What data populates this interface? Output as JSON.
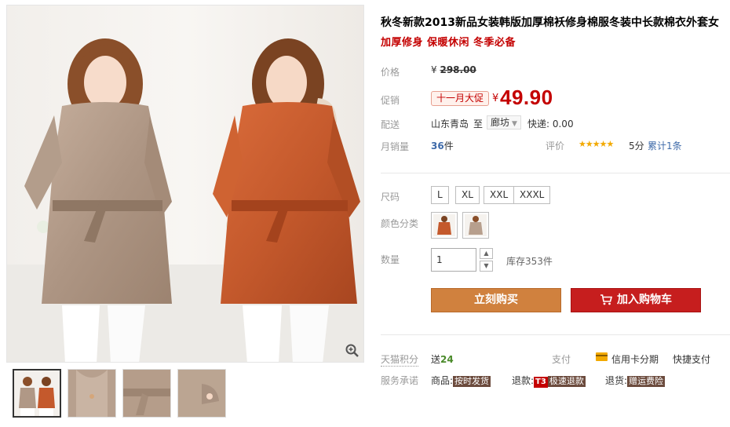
{
  "product": {
    "title": "秋冬新款2013新品女装韩版加厚棉袄修身棉服冬装中长款棉衣外套女",
    "subtitle": "加厚修身 保暖休闲 冬季必备"
  },
  "labels": {
    "price": "价格",
    "promo": "促销",
    "shipping": "配送",
    "monthly_sales": "月销量",
    "rating": "评价",
    "size": "尺码",
    "color": "颜色分类",
    "quantity": "数量",
    "points": "天猫积分",
    "payment": "支付",
    "promise": "服务承诺"
  },
  "price": {
    "currency": "¥",
    "original": "298.00",
    "promo_tag": "十一月大促",
    "current": "49.90"
  },
  "shipping": {
    "from": "山东青岛",
    "to_word": "至",
    "destination": "廊坊",
    "express": "快递: 0.00"
  },
  "sales": {
    "count": "36",
    "unit": "件",
    "stars": "★★★★★",
    "score": "5分",
    "reviews": "累计1条"
  },
  "sizes": [
    "L",
    "XL",
    "XXL",
    "XXXL"
  ],
  "colors": [
    {
      "name": "orange-coat",
      "hex": "#c4592c"
    },
    {
      "name": "beige-coat",
      "hex": "#b79f8d"
    }
  ],
  "quantity": {
    "value": "1",
    "up": "▲",
    "down": "▼",
    "stock": "库存353件"
  },
  "actions": {
    "buy": "立刻购买",
    "add_to_cart": "加入购物车"
  },
  "points": {
    "prefix": "送",
    "value": "24"
  },
  "payment": {
    "credit": "信用卡分期",
    "quick": "快捷支付"
  },
  "promises": [
    {
      "prefix": "商品:",
      "tag": "按时发货"
    },
    {
      "prefix": "退款:",
      "badge": "T3",
      "tag": "极速退款"
    },
    {
      "prefix": "退货:",
      "tag": "赠运费险"
    }
  ],
  "colors_theme": {
    "price_red": "#c40000",
    "buy_orange": "#d0813e",
    "cart_red": "#c61e1e",
    "link_blue": "#3e6aa9"
  }
}
